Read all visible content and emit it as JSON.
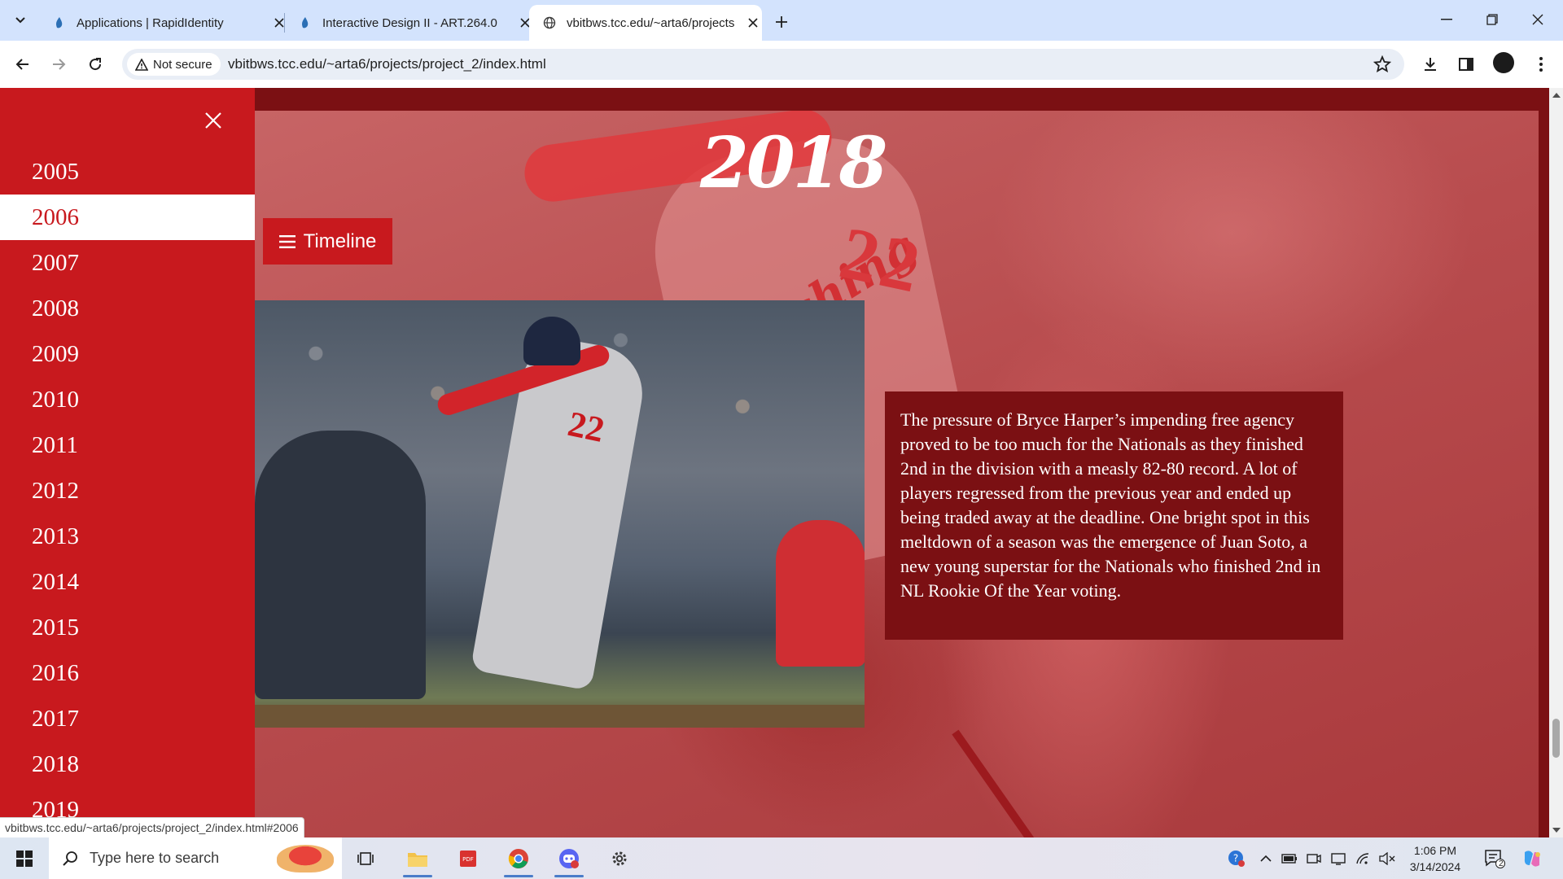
{
  "browser": {
    "tabs": [
      {
        "title": "Applications | RapidIdentity",
        "active": false,
        "favicon": "rapididentity-icon"
      },
      {
        "title": "Interactive Design II - ART.264.0",
        "active": false,
        "favicon": "rapididentity-icon"
      },
      {
        "title": "vbitbws.tcc.edu/~arta6/projects",
        "active": true,
        "favicon": "globe-icon"
      }
    ],
    "security_label": "Not secure",
    "url": "vbitbws.tcc.edu/~arta6/projects/project_2/index.html"
  },
  "page": {
    "timeline_button": "Timeline",
    "current_year": "2018",
    "caption": "The pressure of Bryce Harper’s impending free agency proved to be too much for the Nationals as they finished 2nd in the division with a measly 82-80 record. A lot of players regressed from the previous year and ended up being traded away at the deadline. One bright spot in this meltdown of a season was the emergence of Juan Soto, a new young superstar for the Nationals who finished 2nd in NL Rookie Of the Year voting.",
    "sidebar": {
      "years": [
        "2005",
        "2006",
        "2007",
        "2008",
        "2009",
        "2010",
        "2011",
        "2012",
        "2013",
        "2014",
        "2015",
        "2016",
        "2017",
        "2018",
        "2019"
      ],
      "active_year": "2006"
    },
    "colors": {
      "accent": "#c8191e",
      "dark": "#7b1013"
    }
  },
  "status_bar": "vbitbws.tcc.edu/~arta6/projects/project_2/index.html#2006",
  "taskbar": {
    "search_placeholder": "Type here to search",
    "time": "1:06 PM",
    "date": "3/14/2024",
    "notification_count": "2"
  }
}
